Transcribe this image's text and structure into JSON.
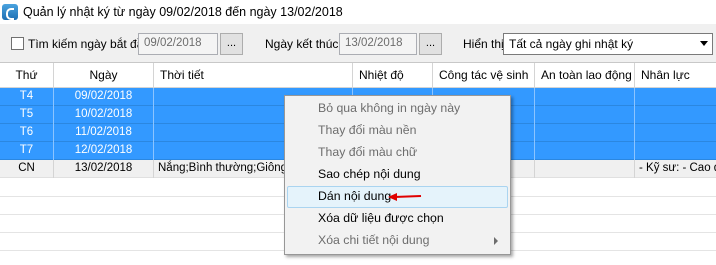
{
  "window": {
    "title": "Quản lý nhật ký từ ngày 09/02/2018 đến ngày 13/02/2018"
  },
  "filter": {
    "search_label": "Tìm kiếm ngày bắt đầu",
    "search_checked": false,
    "start_date": "09/02/2018",
    "browse_label": "...",
    "end_label": "Ngày kết thúc",
    "end_date": "13/02/2018",
    "display_label": "Hiển thị",
    "display_value": "Tất cả ngày ghi nhật ký"
  },
  "table": {
    "columns": [
      "Thứ",
      "Ngày",
      "Thời tiết",
      "Nhiệt độ",
      "Công tác vệ sinh",
      "An toàn lao động",
      "Nhân lực"
    ],
    "rows": [
      {
        "thu": "T4",
        "ngay": "09/02/2018",
        "thoi_tiet": "",
        "nhan_luc": "",
        "selected": true
      },
      {
        "thu": "T5",
        "ngay": "10/02/2018",
        "thoi_tiet": "",
        "nhan_luc": "",
        "selected": true
      },
      {
        "thu": "T6",
        "ngay": "11/02/2018",
        "thoi_tiet": "",
        "nhan_luc": "",
        "selected": true
      },
      {
        "thu": "T7",
        "ngay": "12/02/2018",
        "thoi_tiet": "",
        "nhan_luc": "",
        "selected": true
      },
      {
        "thu": "CN",
        "ngay": "13/02/2018",
        "thoi_tiet": "Nắng;Bình thường;Giông l",
        "nhan_luc": "- Kỹ sư: - Cao đ",
        "selected": false
      }
    ]
  },
  "context_menu": {
    "items": [
      {
        "label": "Bỏ qua không in ngày này",
        "enabled": false
      },
      {
        "label": "Thay đổi màu nền",
        "enabled": false
      },
      {
        "label": "Thay đổi màu chữ",
        "enabled": false
      },
      {
        "label": "Sao chép nội dung",
        "enabled": true
      },
      {
        "label": "Dán nội dung",
        "enabled": true,
        "highlighted": true
      },
      {
        "label": "Xóa dữ liệu được chọn",
        "enabled": true
      },
      {
        "label": "Xóa chi tiết nội dung",
        "enabled": false,
        "has_submenu": true
      }
    ]
  },
  "colors": {
    "selection": "#3399ff",
    "annotation_arrow": "#e00000"
  }
}
